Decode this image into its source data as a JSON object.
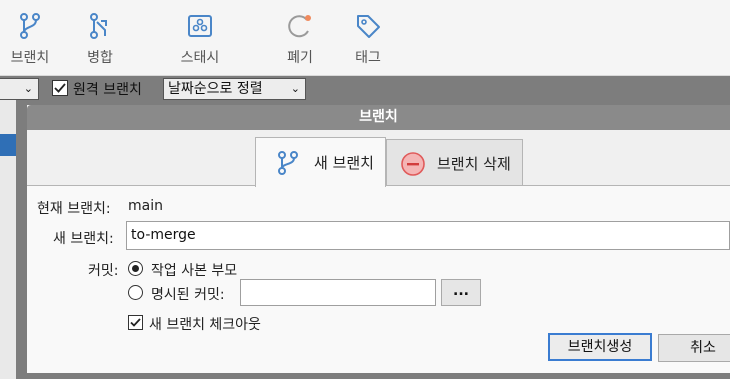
{
  "toolbar": {
    "items": [
      {
        "label": "브랜치",
        "icon": "branch-icon"
      },
      {
        "label": "병합",
        "icon": "merge-icon"
      },
      {
        "label": "스태시",
        "icon": "stash-icon"
      },
      {
        "label": "폐기",
        "icon": "discard-icon"
      },
      {
        "label": "태그",
        "icon": "tag-icon"
      }
    ]
  },
  "background_bar": {
    "remote_branches_label": "원격 브랜치",
    "sort_label": "날짜순으로 정렬"
  },
  "dialog": {
    "title": "브랜치",
    "tabs": [
      {
        "label": "새 브랜치",
        "icon": "branch-icon",
        "active": true
      },
      {
        "label": "브랜치 삭제",
        "icon": "delete-branch-icon",
        "active": false
      }
    ],
    "current_branch_label": "현재 브랜치:",
    "current_branch_value": "main",
    "new_branch_label": "새 브랜치:",
    "new_branch_value": "to-merge",
    "commit_label": "커밋:",
    "commit_option_working_copy": "작업 사본 부모",
    "commit_option_specified": "명시된 커밋:",
    "browse_button": "...",
    "checkout_label": "새 브랜치 체크아웃",
    "create_button": "브랜치생성",
    "cancel_button": "취소"
  },
  "colors": {
    "accent": "#3a7cd1",
    "icon_blue": "#4a86c8",
    "delete_red": "#e05a5a",
    "discard_dot": "#f08a5d"
  }
}
